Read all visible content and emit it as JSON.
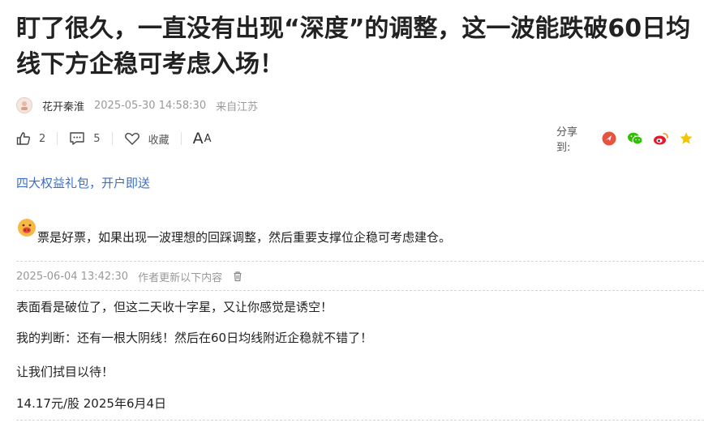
{
  "article": {
    "title": "盯了很久，一直没有出现“深度”的调整，这一波能跌破60日均线下方企稳可考虑入场！",
    "author": "花开秦淮",
    "publish_time": "2025-05-30 14:58:30",
    "location": "来自江苏"
  },
  "toolbar": {
    "like_count": "2",
    "comment_count": "5",
    "favorite_label": "收藏",
    "font_big": "A",
    "font_small": "A"
  },
  "share": {
    "label": "分享到:",
    "targets": [
      "toutiao-icon",
      "wechat-icon",
      "weibo-icon",
      "favorite-star-icon"
    ]
  },
  "promo": {
    "text": "四大权益礼包，开户即送"
  },
  "first_paragraph": "票是好票，如果出现一波理想的回踩调整，然后重要支撑位企稳可考虑建仓。",
  "update": {
    "time": "2025-06-04 13:42:30",
    "note": "作者更新以下内容",
    "lines": [
      "表面看是破位了，但这二天收十字星，又让你感觉是诱空！",
      "我的判断：还有一根大阴线！然后在60日均线附近企稳就不错了！",
      "让我们拭目以待！",
      "14.17元/股 2025年6月4日"
    ]
  },
  "colors": {
    "link": "#3a6ecb",
    "muted": "#999999",
    "title": "#222222",
    "toutiao": "#e8533f",
    "wechat": "#2dc100",
    "weibo": "#e6162d",
    "star": "#f5c400"
  }
}
